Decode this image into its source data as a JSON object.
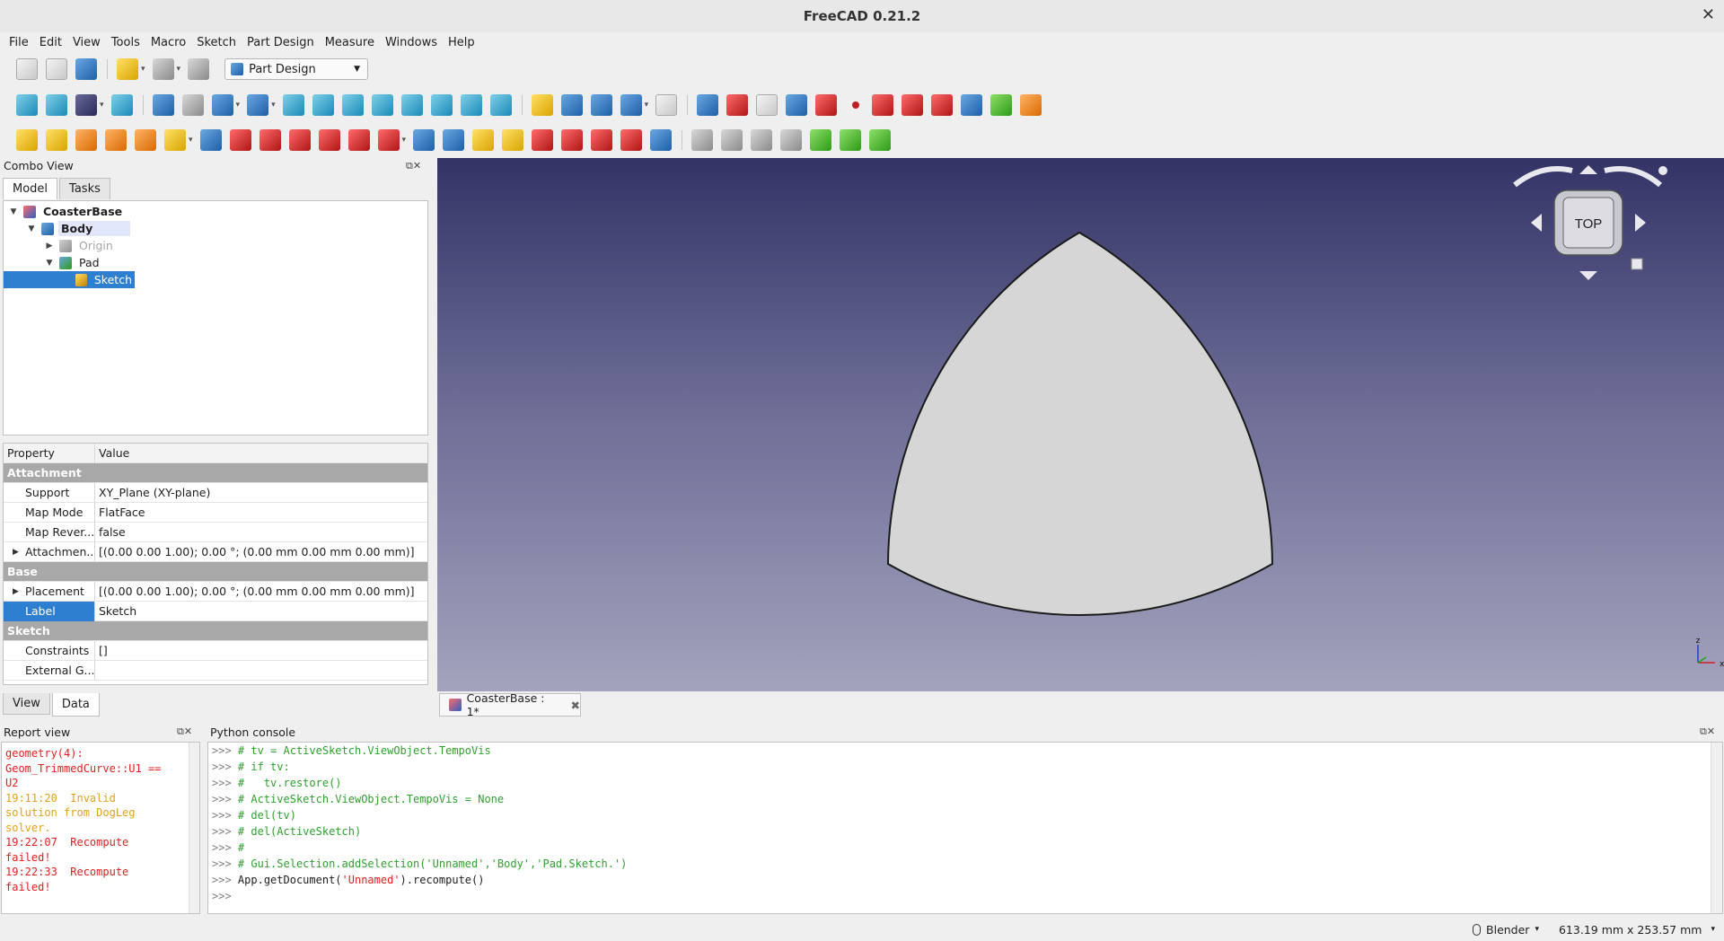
{
  "window": {
    "title": "FreeCAD 0.21.2",
    "close_glyph": "✕"
  },
  "menu": [
    "File",
    "Edit",
    "View",
    "Tools",
    "Macro",
    "Sketch",
    "Part Design",
    "Measure",
    "Windows",
    "Help"
  ],
  "workbench": {
    "selected": "Part Design"
  },
  "combo_view": {
    "title": "Combo View",
    "tabs": [
      "Model",
      "Tasks"
    ],
    "tree": [
      {
        "label": "CoasterBase",
        "icon": "document-icon",
        "state": "normal"
      },
      {
        "label": "Body",
        "icon": "body-icon",
        "state": "body-active"
      },
      {
        "label": "Origin",
        "icon": "origin-icon",
        "state": "disabled"
      },
      {
        "label": "Pad",
        "icon": "pad-icon",
        "state": "normal"
      },
      {
        "label": "Sketch",
        "icon": "sketch-icon",
        "state": "selected"
      }
    ]
  },
  "property_editor": {
    "headers": {
      "property": "Property",
      "value": "Value"
    },
    "groups": [
      {
        "name": "Attachment",
        "rows": [
          {
            "name": "Support",
            "value": "XY_Plane (XY-plane)"
          },
          {
            "name": "Map Mode",
            "value": "FlatFace"
          },
          {
            "name": "Map Rever...",
            "value": "false"
          },
          {
            "name": "Attachmen...",
            "value": "[(0.00 0.00 1.00); 0.00 °; (0.00 mm  0.00 mm  0.00 mm)]"
          }
        ]
      },
      {
        "name": "Base",
        "rows": [
          {
            "name": "Placement",
            "value": "[(0.00 0.00 1.00); 0.00 °; (0.00 mm  0.00 mm  0.00 mm)]"
          },
          {
            "name": "Label",
            "value": "Sketch"
          }
        ]
      },
      {
        "name": "Sketch",
        "rows": [
          {
            "name": "Constraints",
            "value": "[]"
          },
          {
            "name": "External G...",
            "value": ""
          }
        ]
      }
    ],
    "bottom_tabs": [
      "View",
      "Data"
    ]
  },
  "view3d": {
    "navcube_face": "TOP",
    "document_tab": "CoasterBase : 1*",
    "axis_labels": {
      "x": "x",
      "z": "z"
    },
    "colors": {
      "bg_top": "#333366",
      "bg_bottom": "#a3a3bd",
      "shape_fill": "#d6d6d6"
    }
  },
  "report_view": {
    "title": "Report view",
    "lines": [
      {
        "text": "geometry(4):",
        "level": "error"
      },
      {
        "text": "Geom_TrimmedCurve::U1 ==",
        "level": "error"
      },
      {
        "text": "U2",
        "level": "error"
      },
      {
        "text": "19:11:20  Invalid",
        "level": "warning"
      },
      {
        "text": "solution from DogLeg",
        "level": "warning"
      },
      {
        "text": "solver.",
        "level": "warning"
      },
      {
        "text": "19:22:07  Recompute",
        "level": "error"
      },
      {
        "text": "failed!",
        "level": "error"
      },
      {
        "text": "19:22:33  Recompute",
        "level": "error"
      },
      {
        "text": "failed!",
        "level": "error"
      }
    ]
  },
  "python_console": {
    "title": "Python console",
    "lines": [
      {
        "prompt": ">>>",
        "comment": "# tv = ActiveSketch.ViewObject.TempoVis"
      },
      {
        "prompt": ">>>",
        "comment": "# if tv:"
      },
      {
        "prompt": ">>>",
        "comment": "#   tv.restore()"
      },
      {
        "prompt": ">>>",
        "comment": "# ActiveSketch.ViewObject.TempoVis = None"
      },
      {
        "prompt": ">>>",
        "comment": "# del(tv)"
      },
      {
        "prompt": ">>>",
        "comment": "# del(ActiveSketch)"
      },
      {
        "prompt": ">>>",
        "comment": "#"
      },
      {
        "prompt": ">>>",
        "comment": "# Gui.Selection.addSelection('Unnamed','Body','Pad.Sketch.')"
      },
      {
        "prompt": ">>>",
        "code_a": "App.getDocument(",
        "str": "'Unnamed'",
        "code_b": ").recompute()"
      },
      {
        "prompt": ">>>"
      }
    ]
  },
  "status_bar": {
    "nav_style": "Blender",
    "dimensions": "613.19 mm x 253.57 mm"
  }
}
